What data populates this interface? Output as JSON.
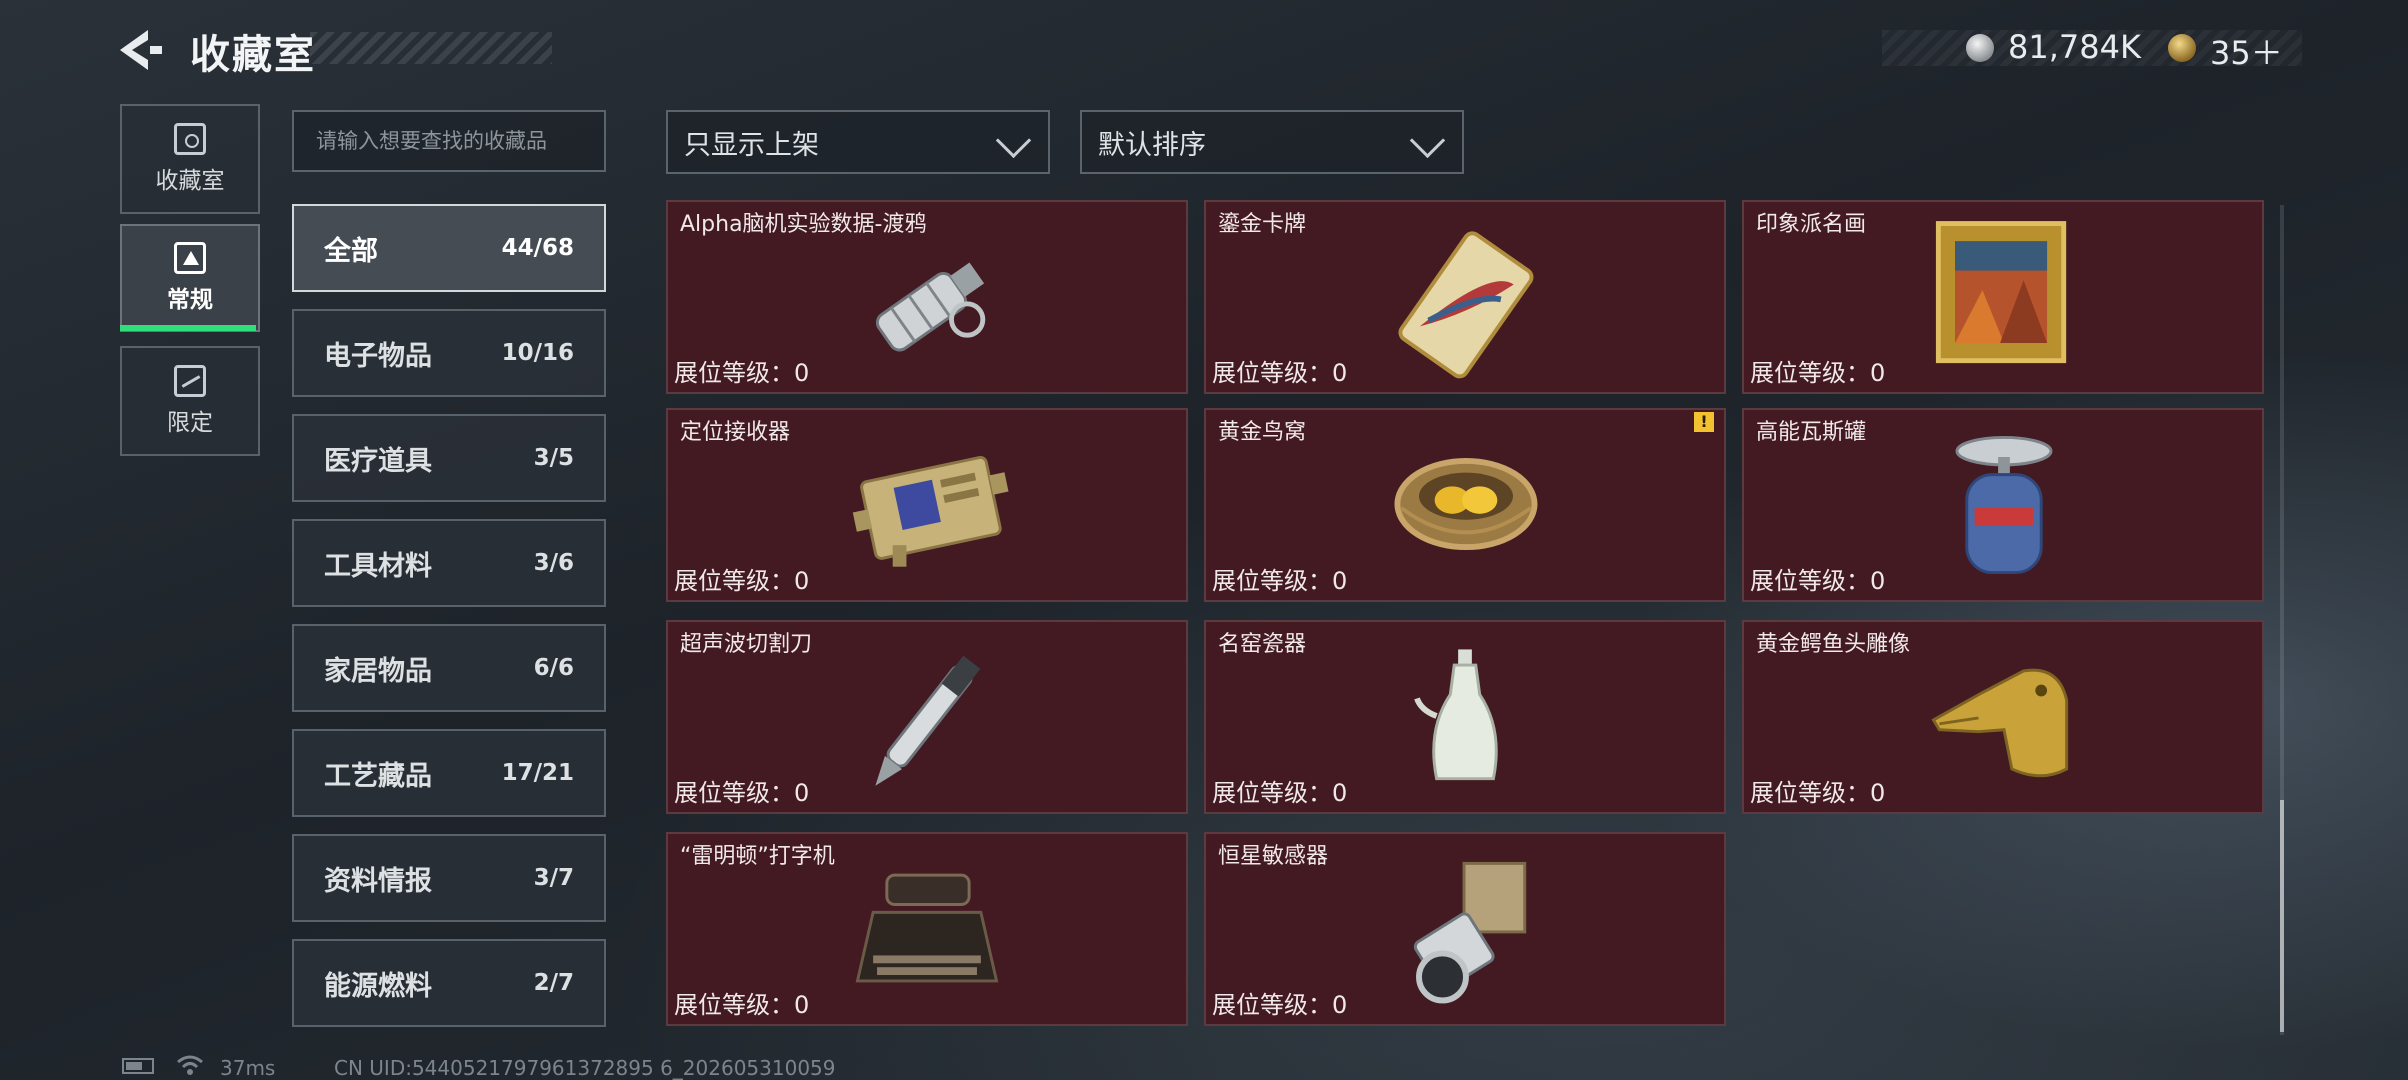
{
  "header": {
    "title": "收藏室",
    "currency_silver": "81,784K",
    "currency_gold": "35＋"
  },
  "nav": [
    {
      "label": "收藏室",
      "icon": "vault-icon"
    },
    {
      "label": "常规",
      "icon": "regular-items-icon"
    },
    {
      "label": "限定",
      "icon": "limited-items-icon"
    }
  ],
  "search": {
    "placeholder": "请输入想要查找的收藏品"
  },
  "filters": {
    "display_filter": "只显示上架",
    "sort": "默认排序"
  },
  "categories": [
    {
      "name": "全部",
      "count": "44/68"
    },
    {
      "name": "电子物品",
      "count": "10/16"
    },
    {
      "name": "医疗道具",
      "count": "3/5"
    },
    {
      "name": "工具材料",
      "count": "3/6"
    },
    {
      "name": "家居物品",
      "count": "6/6"
    },
    {
      "name": "工艺藏品",
      "count": "17/21"
    },
    {
      "name": "资料情报",
      "count": "3/7"
    },
    {
      "name": "能源燃料",
      "count": "2/7"
    }
  ],
  "items": [
    {
      "name": "Alpha脑机实验数据-渡鸦",
      "level": "展位等级：0",
      "icon": "data-drive-icon"
    },
    {
      "name": "鎏金卡牌",
      "level": "展位等级：0",
      "icon": "gilded-card-icon"
    },
    {
      "name": "印象派名画",
      "level": "展位等级：0",
      "icon": "painting-icon"
    },
    {
      "name": "定位接收器",
      "level": "展位等级：0",
      "icon": "receiver-icon"
    },
    {
      "name": "黄金鸟窝",
      "level": "展位等级：0",
      "icon": "golden-nest-icon",
      "warning": "!"
    },
    {
      "name": "高能瓦斯罐",
      "level": "展位等级：0",
      "icon": "gas-canister-icon"
    },
    {
      "name": "超声波切割刀",
      "level": "展位等级：0",
      "icon": "ultrasonic-knife-icon"
    },
    {
      "name": "名窑瓷器",
      "level": "展位等级：0",
      "icon": "porcelain-vase-icon"
    },
    {
      "name": "黄金鳄鱼头雕像",
      "level": "展位等级：0",
      "icon": "gold-crocodile-icon"
    },
    {
      "name": "“雷明顿”打字机",
      "level": "展位等级：0",
      "icon": "typewriter-icon"
    },
    {
      "name": "恒星敏感器",
      "level": "展位等级：0",
      "icon": "star-sensor-icon"
    }
  ],
  "status_bar": {
    "ping": "37ms",
    "uid": "CN UID:5440521797961372895 6_202605310059"
  },
  "colors": {
    "card_bg": "#431a22",
    "nav_active_underline": "#2fe07a",
    "warning": "#f2c230"
  }
}
